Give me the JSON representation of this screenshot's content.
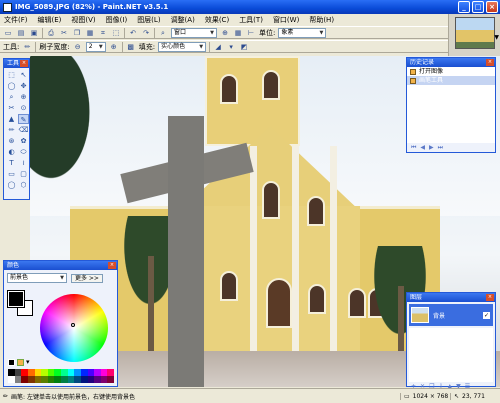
{
  "window": {
    "title": "IMG_5089.JPG (82%) - Paint.NET v3.5.1",
    "minimize": "_",
    "maximize": "□",
    "close": "×"
  },
  "menu": [
    "文件(F)",
    "编辑(E)",
    "视图(V)",
    "图像(I)",
    "图层(L)",
    "调整(A)",
    "效果(C)",
    "工具(T)",
    "窗口(W)",
    "帮助(H)"
  ],
  "toolbar1": {
    "zoom_value": "窗口",
    "units_label": "单位:",
    "units_value": "象素"
  },
  "toolbar2": {
    "tool_label": "工具:",
    "brush_width_label": "刷子宽度:",
    "brush_width_value": "2",
    "fill_label": "填充:",
    "fill_value": "实心颜色"
  },
  "tools_panel": {
    "title": "工具",
    "items": [
      "⬚",
      "↖",
      "◯",
      "✥",
      "⌕",
      "⊕",
      "✂",
      "⊙",
      "▲",
      "✎",
      "✏",
      "⌫",
      "⊛",
      "✿",
      "◐",
      "⬭",
      "T",
      "≀",
      "▭",
      "▢",
      "◯",
      "⬡"
    ]
  },
  "history_panel": {
    "title": "历史记录",
    "rows": [
      "打开图像",
      "画笔工具"
    ]
  },
  "palette_panel": {
    "title": "颜色",
    "mode_value": "前景色",
    "more_button": "更多 >>"
  },
  "layers_panel": {
    "title": "图层",
    "layer_name": "背景"
  },
  "status": {
    "hint": "画笔: 左键单击以使用前景色，右键使用背景色",
    "image_size": "1024 × 768",
    "cursor_pos": "23, 771"
  },
  "colors": {
    "accent": "#1a4fd0",
    "palette": [
      "#000000",
      "#404040",
      "#ff0000",
      "#ff6a00",
      "#ffd800",
      "#b6ff00",
      "#4cff00",
      "#00ff21",
      "#00ff90",
      "#00ffff",
      "#0094ff",
      "#0026ff",
      "#4800ff",
      "#b200ff",
      "#ff00dc",
      "#ff006e",
      "#ffffff",
      "#808080",
      "#7f0000",
      "#7f3300",
      "#7f6a00",
      "#5b7f00",
      "#267f00",
      "#007f0e",
      "#007f46",
      "#007f7f",
      "#004a7f",
      "#00137f",
      "#21007f",
      "#57007f",
      "#7f006e",
      "#7f0037"
    ]
  }
}
